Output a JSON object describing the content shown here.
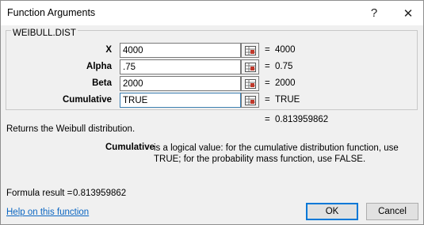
{
  "window": {
    "title": "Function Arguments",
    "help_glyph": "?",
    "close_glyph": "✕"
  },
  "function_name": "WEIBULL.DIST",
  "arguments": [
    {
      "label": "X",
      "value": "4000",
      "equals": "=",
      "evaluated": "4000"
    },
    {
      "label": "Alpha",
      "value": ".75",
      "equals": "=",
      "evaluated": "0.75"
    },
    {
      "label": "Beta",
      "value": "2000",
      "equals": "=",
      "evaluated": "2000"
    },
    {
      "label": "Cumulative",
      "value": "TRUE",
      "equals": "=",
      "evaluated": "TRUE"
    }
  ],
  "result": {
    "equals": "=",
    "value": "0.813959862"
  },
  "description": "Returns the Weibull distribution.",
  "argument_help": {
    "name": "Cumulative",
    "text": "is a logical value: for the cumulative distribution function, use TRUE; for the probability mass function, use FALSE."
  },
  "formula_result": {
    "label": "Formula result =",
    "value": "0.813959862"
  },
  "footer": {
    "help_link": "Help on this function",
    "ok_label": "OK",
    "cancel_label": "Cancel"
  },
  "icons": {
    "ref_button": "range-selector-icon"
  },
  "colors": {
    "link": "#0b66c2",
    "ok_border": "#0078d7",
    "ref_icon_red": "#c0392b"
  }
}
